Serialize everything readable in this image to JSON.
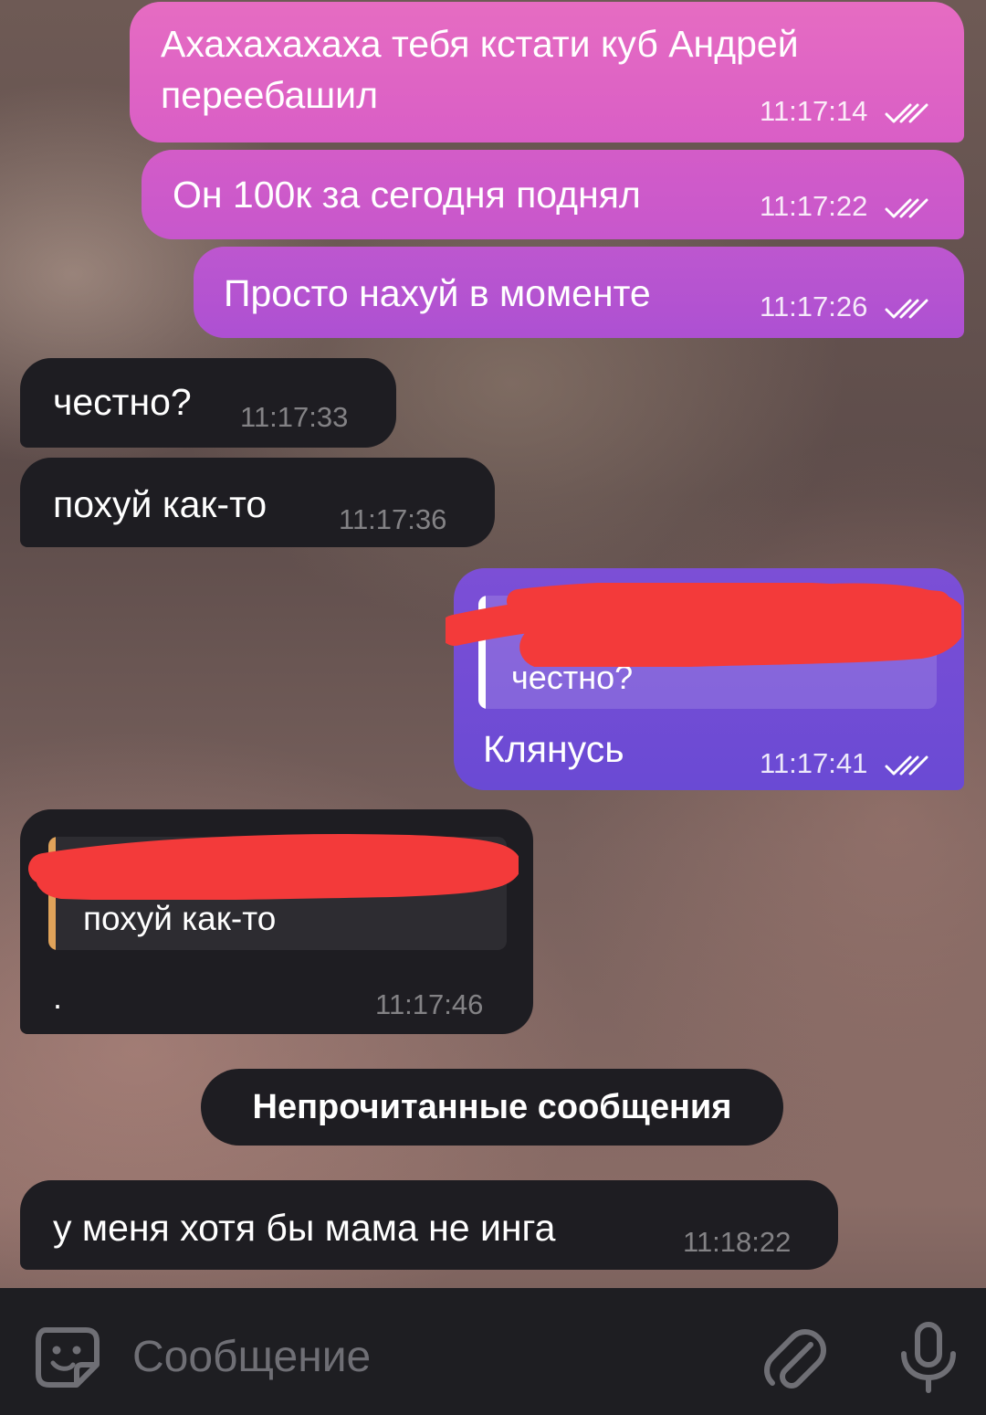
{
  "messages": [
    {
      "id": "m1",
      "direction": "outgoing",
      "text_line1": "Ахахахахаха тебя кстати куб Андрей",
      "text_line2": "переебашил",
      "time": "11:17:14",
      "read": true
    },
    {
      "id": "m2",
      "direction": "outgoing",
      "text": "Он 100к за сегодня поднял",
      "time": "11:17:22",
      "read": true
    },
    {
      "id": "m3",
      "direction": "outgoing",
      "text": "Просто нахуй в моменте",
      "time": "11:17:26",
      "read": true
    },
    {
      "id": "m4",
      "direction": "incoming",
      "text": "честно?",
      "time": "11:17:33"
    },
    {
      "id": "m5",
      "direction": "incoming",
      "text": "похуй как-то",
      "time": "11:17:36"
    },
    {
      "id": "m6",
      "direction": "outgoing",
      "reply_quote": "честно?",
      "text": "Клянусь",
      "time": "11:17:41",
      "read": true
    },
    {
      "id": "m7",
      "direction": "incoming",
      "reply_quote": "похуй как-то",
      "text": ".",
      "time": "11:17:46"
    },
    {
      "id": "m8",
      "direction": "incoming",
      "text": "у меня хотя бы мама не инга",
      "time": "11:18:22"
    }
  ],
  "unread_divider": "Непрочитанные сообщения",
  "composer": {
    "placeholder": "Сообщение",
    "emoji_icon": "sticker-emoji-icon",
    "attach_icon": "paperclip-icon",
    "voice_icon": "microphone-icon"
  },
  "colors": {
    "outgoing_pink": "#e066c4",
    "outgoing_purple": "#6a4ad4",
    "incoming": "#1e1d22",
    "redaction": "#f33a3a",
    "reply_accent_incoming": "#e0a35a"
  }
}
